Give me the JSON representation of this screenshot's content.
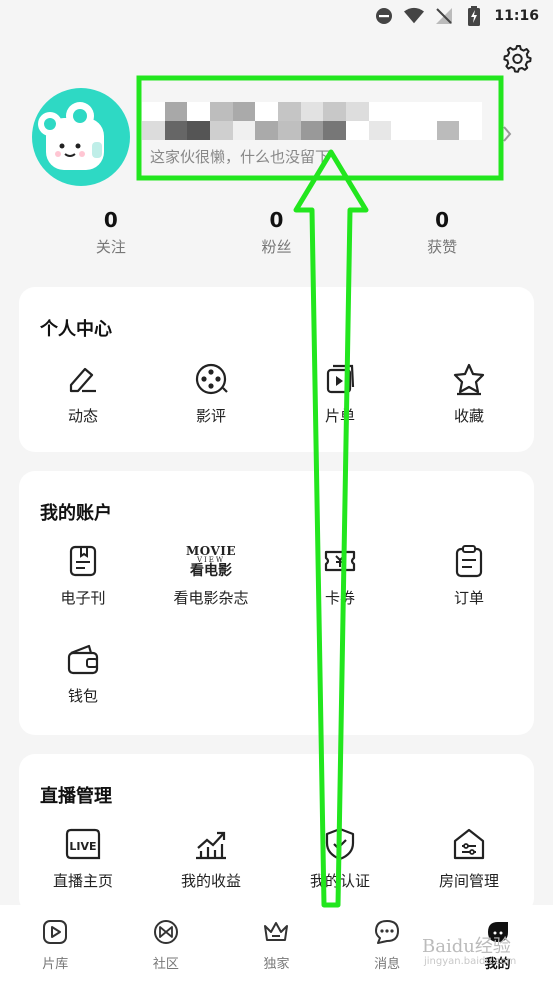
{
  "status_bar": {
    "time": "11:16"
  },
  "profile": {
    "bio": "这家伙很懒，什么也没留下"
  },
  "stats": [
    {
      "value": "0",
      "label": "关注"
    },
    {
      "value": "0",
      "label": "粉丝"
    },
    {
      "value": "0",
      "label": "获赞"
    }
  ],
  "personal_center": {
    "title": "个人中心",
    "items": [
      {
        "label": "动态",
        "icon": "edit-icon"
      },
      {
        "label": "影评",
        "icon": "film-reel-icon"
      },
      {
        "label": "片单",
        "icon": "playlist-icon"
      },
      {
        "label": "收藏",
        "icon": "star-icon"
      }
    ]
  },
  "my_account": {
    "title": "我的账户",
    "items": [
      {
        "label": "电子刊",
        "icon": "ebook-icon"
      },
      {
        "label": "看电影杂志",
        "icon": "movie-view-logo-icon",
        "logo_top": "MOVIE",
        "logo_mid": "VIEW",
        "logo_bottom": "看电影"
      },
      {
        "label": "卡券",
        "icon": "ticket-icon"
      },
      {
        "label": "订单",
        "icon": "order-icon"
      },
      {
        "label": "钱包",
        "icon": "wallet-icon"
      }
    ]
  },
  "live_management": {
    "title": "直播管理",
    "items": [
      {
        "label": "直播主页",
        "icon": "live-icon",
        "badge": "LIVE"
      },
      {
        "label": "我的收益",
        "icon": "earnings-icon"
      },
      {
        "label": "我的认证",
        "icon": "shield-check-icon"
      },
      {
        "label": "房间管理",
        "icon": "room-settings-icon"
      }
    ]
  },
  "tabbar": {
    "items": [
      {
        "label": "片库",
        "icon": "play-square-icon"
      },
      {
        "label": "社区",
        "icon": "community-icon"
      },
      {
        "label": "独家",
        "icon": "crown-icon"
      },
      {
        "label": "消息",
        "icon": "message-icon"
      },
      {
        "label": "我的",
        "icon": "profile-blob-icon"
      }
    ],
    "active_index": 4
  },
  "watermark": {
    "text": "Baidu经验",
    "sub": "jingyan.baidu.com"
  },
  "colors": {
    "accent": "#2ed9c4",
    "annotation": "#22e61e"
  }
}
